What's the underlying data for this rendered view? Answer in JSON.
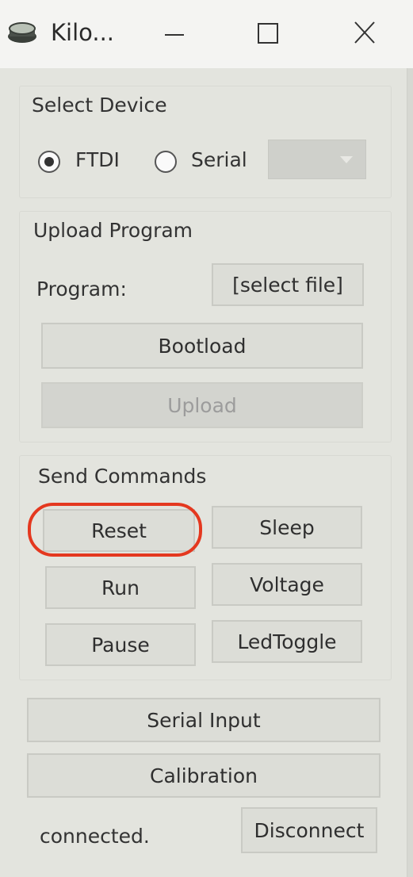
{
  "window": {
    "title": "Kilo...",
    "minimize_icon": "minimize-icon",
    "maximize_icon": "maximize-icon",
    "close_icon": "close-icon"
  },
  "select_device": {
    "heading": "Select Device",
    "options": [
      {
        "label": "FTDI",
        "checked": true
      },
      {
        "label": "Serial",
        "checked": false
      }
    ],
    "port_value": ""
  },
  "upload_program": {
    "heading": "Upload Program",
    "program_label": "Program:",
    "select_file": "[select file]",
    "bootload": "Bootload",
    "upload": "Upload"
  },
  "send_commands": {
    "heading": "Send Commands",
    "buttons": [
      "Reset",
      "Sleep",
      "Run",
      "Voltage",
      "Pause",
      "LedToggle"
    ]
  },
  "serial_input": "Serial Input",
  "calibration": "Calibration",
  "status": "connected.",
  "disconnect": "Disconnect",
  "colors": {
    "highlight": "#e4381f",
    "background": "#e3e4de"
  }
}
